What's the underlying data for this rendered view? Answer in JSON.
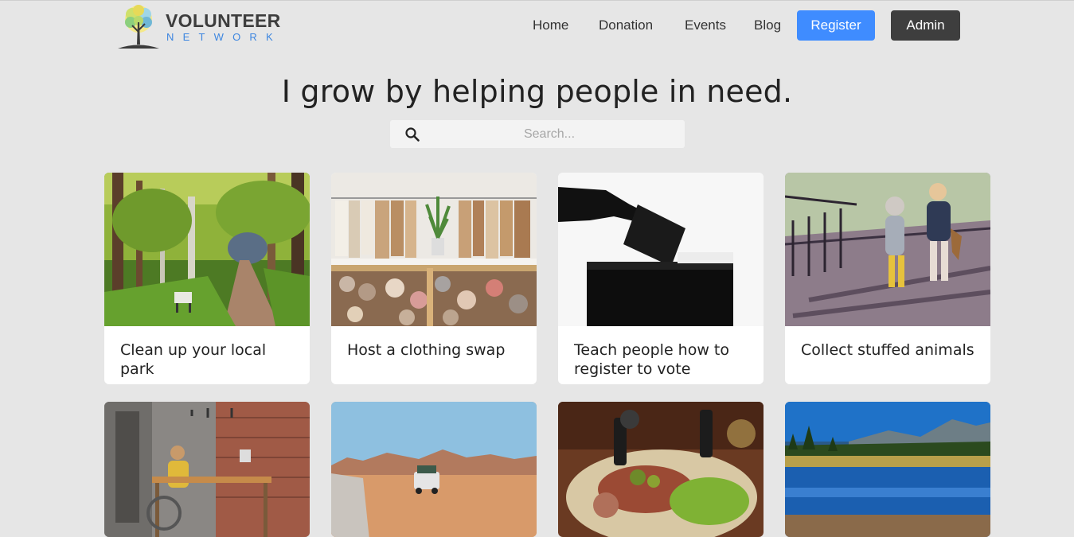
{
  "brand": {
    "title": "VOLUNTEER",
    "subtitle": "NETWORK"
  },
  "nav": {
    "links": [
      "Home",
      "Donation",
      "Events",
      "Blog"
    ],
    "register_label": "Register",
    "admin_label": "Admin"
  },
  "hero": {
    "title": "I grow by helping people in need."
  },
  "search": {
    "placeholder": "Search...",
    "value": ""
  },
  "cards": [
    {
      "title": "Clean up your local park",
      "image": "park-path-photo"
    },
    {
      "title": "Host a clothing swap",
      "image": "clothing-rack-photo"
    },
    {
      "title": "Teach people how to register to vote",
      "image": "ballot-box-photo"
    },
    {
      "title": "Collect stuffed animals",
      "image": "children-bridge-photo"
    },
    {
      "title": "",
      "image": "cafe-table-photo"
    },
    {
      "title": "",
      "image": "desert-jeep-photo"
    },
    {
      "title": "",
      "image": "food-platter-photo"
    },
    {
      "title": "",
      "image": "mountain-lake-photo"
    }
  ],
  "colors": {
    "accent": "#3f8cff",
    "admin": "#3e3e3e",
    "background": "#e6e6e6",
    "brand_blue": "#3d86e0"
  }
}
